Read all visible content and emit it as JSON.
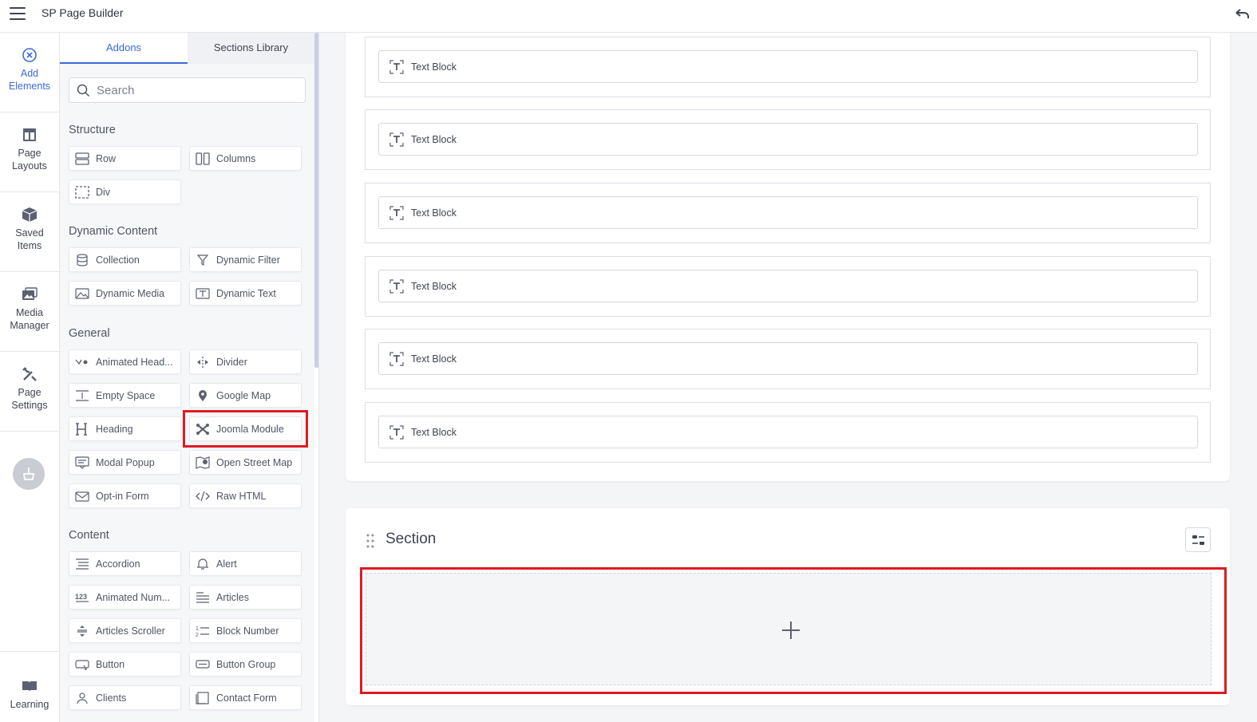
{
  "app": {
    "title": "SP Page Builder"
  },
  "rail": {
    "items": [
      {
        "label": "Add Elements",
        "icon": "add-elements-icon"
      },
      {
        "label": "Page Layouts",
        "icon": "page-layouts-icon"
      },
      {
        "label": "Saved Items",
        "icon": "saved-items-icon"
      },
      {
        "label": "Media Manager",
        "icon": "media-manager-icon"
      },
      {
        "label": "Page Settings",
        "icon": "page-settings-icon"
      }
    ],
    "bottom": {
      "label": "Learning",
      "icon": "book-icon"
    }
  },
  "panel": {
    "tabs": [
      {
        "label": "Addons"
      },
      {
        "label": "Sections Library"
      }
    ],
    "search": {
      "placeholder": "Search",
      "value": ""
    },
    "categories": [
      {
        "title": "Structure",
        "addons": [
          {
            "label": "Row",
            "icon": "row-icon"
          },
          {
            "label": "Columns",
            "icon": "columns-icon"
          },
          {
            "label": "Div",
            "icon": "div-icon"
          }
        ]
      },
      {
        "title": "Dynamic Content",
        "addons": [
          {
            "label": "Collection",
            "icon": "collection-icon"
          },
          {
            "label": "Dynamic Filter",
            "icon": "dynamic-filter-icon"
          },
          {
            "label": "Dynamic Media",
            "icon": "dynamic-media-icon"
          },
          {
            "label": "Dynamic Text",
            "icon": "dynamic-text-icon"
          }
        ]
      },
      {
        "title": "General",
        "addons": [
          {
            "label": "Animated Head...",
            "icon": "animated-heading-icon"
          },
          {
            "label": "Divider",
            "icon": "divider-icon"
          },
          {
            "label": "Empty Space",
            "icon": "empty-space-icon"
          },
          {
            "label": "Google Map",
            "icon": "google-map-icon"
          },
          {
            "label": "Heading",
            "icon": "heading-icon"
          },
          {
            "label": "Joomla Module",
            "icon": "joomla-icon"
          },
          {
            "label": "Modal Popup",
            "icon": "modal-popup-icon"
          },
          {
            "label": "Open Street Map",
            "icon": "open-street-map-icon"
          },
          {
            "label": "Opt-in Form",
            "icon": "optin-form-icon"
          },
          {
            "label": "Raw HTML",
            "icon": "code-icon"
          }
        ]
      },
      {
        "title": "Content",
        "addons": [
          {
            "label": "Accordion",
            "icon": "accordion-icon"
          },
          {
            "label": "Alert",
            "icon": "bell-icon"
          },
          {
            "label": "Animated Num...",
            "icon": "animated-number-icon"
          },
          {
            "label": "Articles",
            "icon": "articles-icon"
          },
          {
            "label": "Articles Scroller",
            "icon": "articles-scroller-icon"
          },
          {
            "label": "Block Number",
            "icon": "block-number-icon"
          },
          {
            "label": "Button",
            "icon": "button-icon"
          },
          {
            "label": "Button Group",
            "icon": "button-group-icon"
          },
          {
            "label": "Clients",
            "icon": "clients-icon"
          },
          {
            "label": "Contact Form",
            "icon": "contact-form-icon"
          }
        ]
      }
    ]
  },
  "canvas": {
    "rows": [
      {
        "addon_label": "Text Block"
      },
      {
        "addon_label": "Text Block"
      },
      {
        "addon_label": "Text Block"
      },
      {
        "addon_label": "Text Block"
      },
      {
        "addon_label": "Text Block"
      },
      {
        "addon_label": "Text Block"
      }
    ],
    "section": {
      "title": "Section"
    }
  },
  "colors": {
    "accent": "#3b6bd6",
    "highlight": "#e01a22",
    "canvas_bg": "#f4f5f7"
  }
}
